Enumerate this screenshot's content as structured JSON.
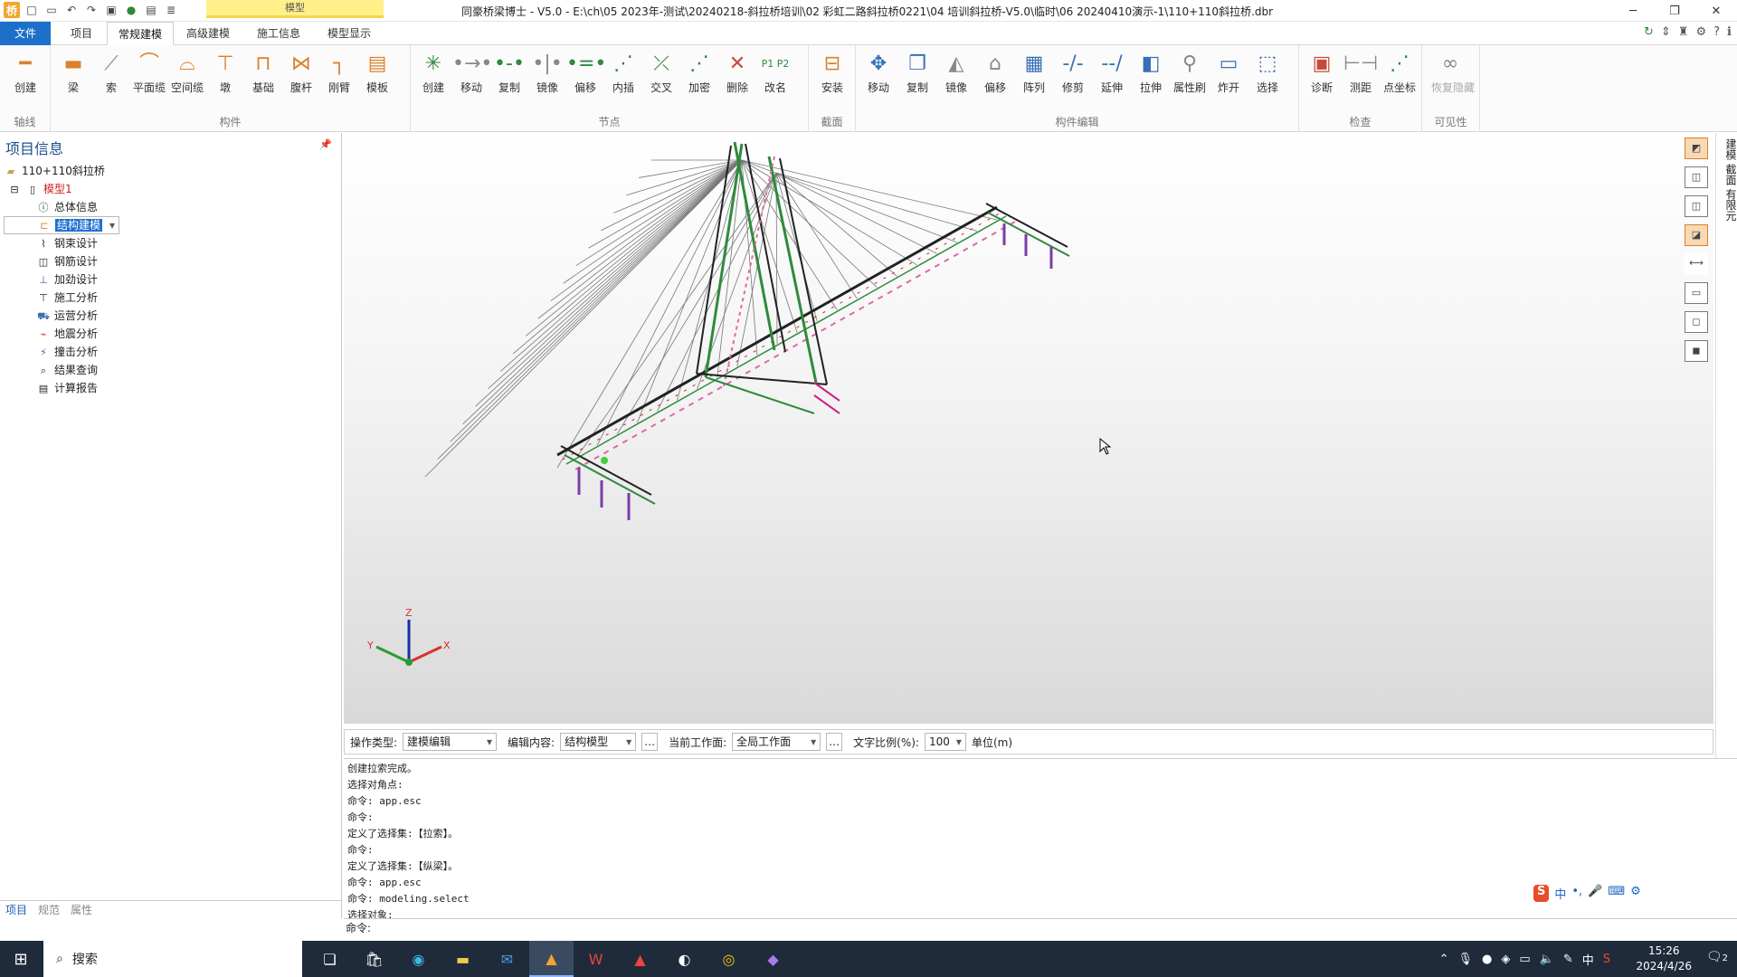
{
  "window": {
    "title": "同豪桥梁博士 - V5.0 - E:\\ch\\05 2023年-测试\\20240218-斜拉桥培训\\02 彩虹二路斜拉桥0221\\04 培训斜拉桥-V5.0\\临时\\06 20240410演示-1\\110+110斜拉桥.dbr",
    "context_tab": "模型",
    "minimize": "─",
    "restore": "❐",
    "close": "✕"
  },
  "tabs": [
    {
      "label": "文件"
    },
    {
      "label": "项目"
    },
    {
      "label": "常规建模"
    },
    {
      "label": "高级建模"
    },
    {
      "label": "施工信息"
    },
    {
      "label": "模型显示"
    }
  ],
  "ribbon": {
    "groups": [
      {
        "label": "轴线",
        "buttons": [
          {
            "label": "创建",
            "icon": "axis-create-icon"
          }
        ]
      },
      {
        "label": "构件",
        "buttons": [
          {
            "label": "梁",
            "icon": "beam-icon"
          },
          {
            "label": "索",
            "icon": "cable-icon"
          },
          {
            "label": "平面缆",
            "icon": "plane-cable-icon"
          },
          {
            "label": "空间缆",
            "icon": "space-cable-icon"
          },
          {
            "label": "墩",
            "icon": "pier-icon"
          },
          {
            "label": "基础",
            "icon": "foundation-icon"
          },
          {
            "label": "腹杆",
            "icon": "web-member-icon"
          },
          {
            "label": "刚臂",
            "icon": "rigid-arm-icon"
          },
          {
            "label": "模板",
            "icon": "template-icon"
          }
        ]
      },
      {
        "label": "节点",
        "buttons": [
          {
            "label": "创建",
            "icon": "node-create-icon"
          },
          {
            "label": "移动",
            "icon": "node-move-icon"
          },
          {
            "label": "复制",
            "icon": "node-copy-icon"
          },
          {
            "label": "镜像",
            "icon": "node-mirror-icon"
          },
          {
            "label": "偏移",
            "icon": "node-offset-icon"
          },
          {
            "label": "内插",
            "icon": "interpolate-icon"
          },
          {
            "label": "交叉",
            "icon": "intersect-icon"
          },
          {
            "label": "加密",
            "icon": "densify-icon"
          },
          {
            "label": "删除",
            "icon": "delete-icon"
          },
          {
            "label": "改名",
            "icon": "rename-icon"
          }
        ]
      },
      {
        "label": "截面",
        "buttons": [
          {
            "label": "安装",
            "icon": "section-install-icon"
          }
        ]
      },
      {
        "label": "构件编辑",
        "buttons": [
          {
            "label": "移动",
            "icon": "member-move-icon"
          },
          {
            "label": "复制",
            "icon": "member-copy-icon"
          },
          {
            "label": "镜像",
            "icon": "member-mirror-icon"
          },
          {
            "label": "偏移",
            "icon": "member-offset-icon"
          },
          {
            "label": "阵列",
            "icon": "array-icon"
          },
          {
            "label": "修剪",
            "icon": "trim-icon"
          },
          {
            "label": "延伸",
            "icon": "extend-icon"
          },
          {
            "label": "拉伸",
            "icon": "stretch-icon"
          },
          {
            "label": "属性刷",
            "icon": "property-brush-icon"
          },
          {
            "label": "炸开",
            "icon": "explode-icon"
          },
          {
            "label": "选择",
            "icon": "select-icon"
          }
        ]
      },
      {
        "label": "检查",
        "buttons": [
          {
            "label": "诊断",
            "icon": "diagnose-icon"
          },
          {
            "label": "测距",
            "icon": "measure-icon"
          },
          {
            "label": "点坐标",
            "icon": "point-coord-icon"
          }
        ]
      },
      {
        "label": "可见性",
        "buttons": [
          {
            "label": "恢复隐藏",
            "icon": "restore-hidden-icon"
          }
        ]
      }
    ],
    "node_labels": "P1 P2"
  },
  "left_panel": {
    "title": "项目信息",
    "tree": [
      {
        "label": "110+110斜拉桥",
        "level": 0,
        "icon": "folder-icon"
      },
      {
        "label": "模型1",
        "level": 1,
        "icon": "doc-icon",
        "red": true
      },
      {
        "label": "总体信息",
        "level": 2,
        "icon": "info-icon"
      },
      {
        "label": "结构建模",
        "level": 2,
        "icon": "structure-icon",
        "selected": true
      },
      {
        "label": "钢束设计",
        "level": 2,
        "icon": "tendon-icon"
      },
      {
        "label": "钢筋设计",
        "level": 2,
        "icon": "rebar-icon"
      },
      {
        "label": "加劲设计",
        "level": 2,
        "icon": "stiffener-icon"
      },
      {
        "label": "施工分析",
        "level": 2,
        "icon": "construction-icon"
      },
      {
        "label": "运营分析",
        "level": 2,
        "icon": "operation-icon"
      },
      {
        "label": "地震分析",
        "level": 2,
        "icon": "seismic-icon"
      },
      {
        "label": "撞击分析",
        "level": 2,
        "icon": "impact-icon"
      },
      {
        "label": "结果查询",
        "level": 2,
        "icon": "query-icon"
      },
      {
        "label": "计算报告",
        "level": 2,
        "icon": "report-icon"
      }
    ],
    "bottom_tabs": [
      "项目",
      "规范",
      "属性"
    ]
  },
  "viewport": {
    "axis_labels": {
      "x": "X",
      "y": "Y",
      "z": "Z"
    },
    "side_tabs": "建模 截面 有限元"
  },
  "option_bar": {
    "op_type_label": "操作类型:",
    "op_type_value": "建模编辑",
    "edit_content_label": "编辑内容:",
    "edit_content_value": "结构模型",
    "workplane_label": "当前工作面:",
    "workplane_value": "全局工作面",
    "text_scale_label": "文字比例(%):",
    "text_scale_value": "100",
    "unit_label": "单位(m)"
  },
  "command_log": [
    "创建拉索完成。",
    "选择对角点:",
    "命令: app.esc",
    "命令:",
    "定义了选择集:【拉索】。",
    "命令:",
    "定义了选择集:【纵梁】。",
    "命令: app.esc",
    "命令: modeling.select",
    "选择对象:"
  ],
  "command_prompt": "命令:",
  "ime": {
    "label": "中"
  },
  "taskbar": {
    "search": "搜索",
    "time": "15:26",
    "date": "2024/4/26",
    "tray_lang": "中",
    "notif_count": "2"
  }
}
